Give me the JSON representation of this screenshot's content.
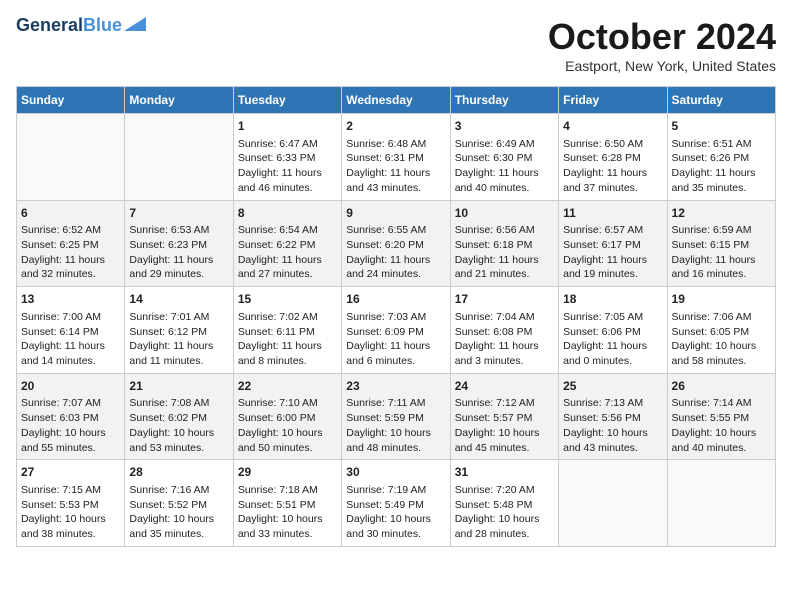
{
  "header": {
    "logo_line1": "General",
    "logo_line2": "Blue",
    "month_title": "October 2024",
    "location": "Eastport, New York, United States"
  },
  "weekdays": [
    "Sunday",
    "Monday",
    "Tuesday",
    "Wednesday",
    "Thursday",
    "Friday",
    "Saturday"
  ],
  "weeks": [
    [
      {
        "day": "",
        "info": ""
      },
      {
        "day": "",
        "info": ""
      },
      {
        "day": "1",
        "info": "Sunrise: 6:47 AM\nSunset: 6:33 PM\nDaylight: 11 hours and 46 minutes."
      },
      {
        "day": "2",
        "info": "Sunrise: 6:48 AM\nSunset: 6:31 PM\nDaylight: 11 hours and 43 minutes."
      },
      {
        "day": "3",
        "info": "Sunrise: 6:49 AM\nSunset: 6:30 PM\nDaylight: 11 hours and 40 minutes."
      },
      {
        "day": "4",
        "info": "Sunrise: 6:50 AM\nSunset: 6:28 PM\nDaylight: 11 hours and 37 minutes."
      },
      {
        "day": "5",
        "info": "Sunrise: 6:51 AM\nSunset: 6:26 PM\nDaylight: 11 hours and 35 minutes."
      }
    ],
    [
      {
        "day": "6",
        "info": "Sunrise: 6:52 AM\nSunset: 6:25 PM\nDaylight: 11 hours and 32 minutes."
      },
      {
        "day": "7",
        "info": "Sunrise: 6:53 AM\nSunset: 6:23 PM\nDaylight: 11 hours and 29 minutes."
      },
      {
        "day": "8",
        "info": "Sunrise: 6:54 AM\nSunset: 6:22 PM\nDaylight: 11 hours and 27 minutes."
      },
      {
        "day": "9",
        "info": "Sunrise: 6:55 AM\nSunset: 6:20 PM\nDaylight: 11 hours and 24 minutes."
      },
      {
        "day": "10",
        "info": "Sunrise: 6:56 AM\nSunset: 6:18 PM\nDaylight: 11 hours and 21 minutes."
      },
      {
        "day": "11",
        "info": "Sunrise: 6:57 AM\nSunset: 6:17 PM\nDaylight: 11 hours and 19 minutes."
      },
      {
        "day": "12",
        "info": "Sunrise: 6:59 AM\nSunset: 6:15 PM\nDaylight: 11 hours and 16 minutes."
      }
    ],
    [
      {
        "day": "13",
        "info": "Sunrise: 7:00 AM\nSunset: 6:14 PM\nDaylight: 11 hours and 14 minutes."
      },
      {
        "day": "14",
        "info": "Sunrise: 7:01 AM\nSunset: 6:12 PM\nDaylight: 11 hours and 11 minutes."
      },
      {
        "day": "15",
        "info": "Sunrise: 7:02 AM\nSunset: 6:11 PM\nDaylight: 11 hours and 8 minutes."
      },
      {
        "day": "16",
        "info": "Sunrise: 7:03 AM\nSunset: 6:09 PM\nDaylight: 11 hours and 6 minutes."
      },
      {
        "day": "17",
        "info": "Sunrise: 7:04 AM\nSunset: 6:08 PM\nDaylight: 11 hours and 3 minutes."
      },
      {
        "day": "18",
        "info": "Sunrise: 7:05 AM\nSunset: 6:06 PM\nDaylight: 11 hours and 0 minutes."
      },
      {
        "day": "19",
        "info": "Sunrise: 7:06 AM\nSunset: 6:05 PM\nDaylight: 10 hours and 58 minutes."
      }
    ],
    [
      {
        "day": "20",
        "info": "Sunrise: 7:07 AM\nSunset: 6:03 PM\nDaylight: 10 hours and 55 minutes."
      },
      {
        "day": "21",
        "info": "Sunrise: 7:08 AM\nSunset: 6:02 PM\nDaylight: 10 hours and 53 minutes."
      },
      {
        "day": "22",
        "info": "Sunrise: 7:10 AM\nSunset: 6:00 PM\nDaylight: 10 hours and 50 minutes."
      },
      {
        "day": "23",
        "info": "Sunrise: 7:11 AM\nSunset: 5:59 PM\nDaylight: 10 hours and 48 minutes."
      },
      {
        "day": "24",
        "info": "Sunrise: 7:12 AM\nSunset: 5:57 PM\nDaylight: 10 hours and 45 minutes."
      },
      {
        "day": "25",
        "info": "Sunrise: 7:13 AM\nSunset: 5:56 PM\nDaylight: 10 hours and 43 minutes."
      },
      {
        "day": "26",
        "info": "Sunrise: 7:14 AM\nSunset: 5:55 PM\nDaylight: 10 hours and 40 minutes."
      }
    ],
    [
      {
        "day": "27",
        "info": "Sunrise: 7:15 AM\nSunset: 5:53 PM\nDaylight: 10 hours and 38 minutes."
      },
      {
        "day": "28",
        "info": "Sunrise: 7:16 AM\nSunset: 5:52 PM\nDaylight: 10 hours and 35 minutes."
      },
      {
        "day": "29",
        "info": "Sunrise: 7:18 AM\nSunset: 5:51 PM\nDaylight: 10 hours and 33 minutes."
      },
      {
        "day": "30",
        "info": "Sunrise: 7:19 AM\nSunset: 5:49 PM\nDaylight: 10 hours and 30 minutes."
      },
      {
        "day": "31",
        "info": "Sunrise: 7:20 AM\nSunset: 5:48 PM\nDaylight: 10 hours and 28 minutes."
      },
      {
        "day": "",
        "info": ""
      },
      {
        "day": "",
        "info": ""
      }
    ]
  ]
}
